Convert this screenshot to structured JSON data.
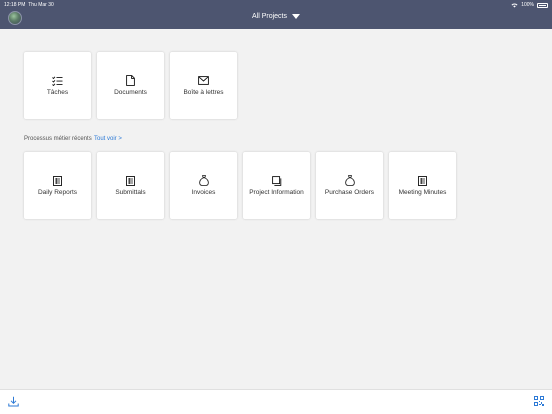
{
  "status": {
    "time": "12:18 PM",
    "date": "Thu Mar 30",
    "battery": "100%"
  },
  "header": {
    "project_picker": "All Projects"
  },
  "quick_actions": [
    {
      "label": "Tâches",
      "icon": "checklist-icon"
    },
    {
      "label": "Documents",
      "icon": "document-icon"
    },
    {
      "label": "Boîte à lettres",
      "icon": "mail-icon"
    }
  ],
  "recent": {
    "title": "Processus métier récents",
    "see_all": "Tout voir >",
    "items": [
      {
        "label": "Daily Reports",
        "icon": "form-icon"
      },
      {
        "label": "Submittals",
        "icon": "form-icon"
      },
      {
        "label": "Invoices",
        "icon": "money-bag-icon"
      },
      {
        "label": "Project Information",
        "icon": "copy-icon"
      },
      {
        "label": "Purchase Orders",
        "icon": "money-bag-icon"
      },
      {
        "label": "Meeting Minutes",
        "icon": "form-icon"
      }
    ]
  },
  "colors": {
    "header_bg": "#4d5570",
    "accent": "#2d7ad6",
    "page_bg": "#f2f2f2"
  }
}
